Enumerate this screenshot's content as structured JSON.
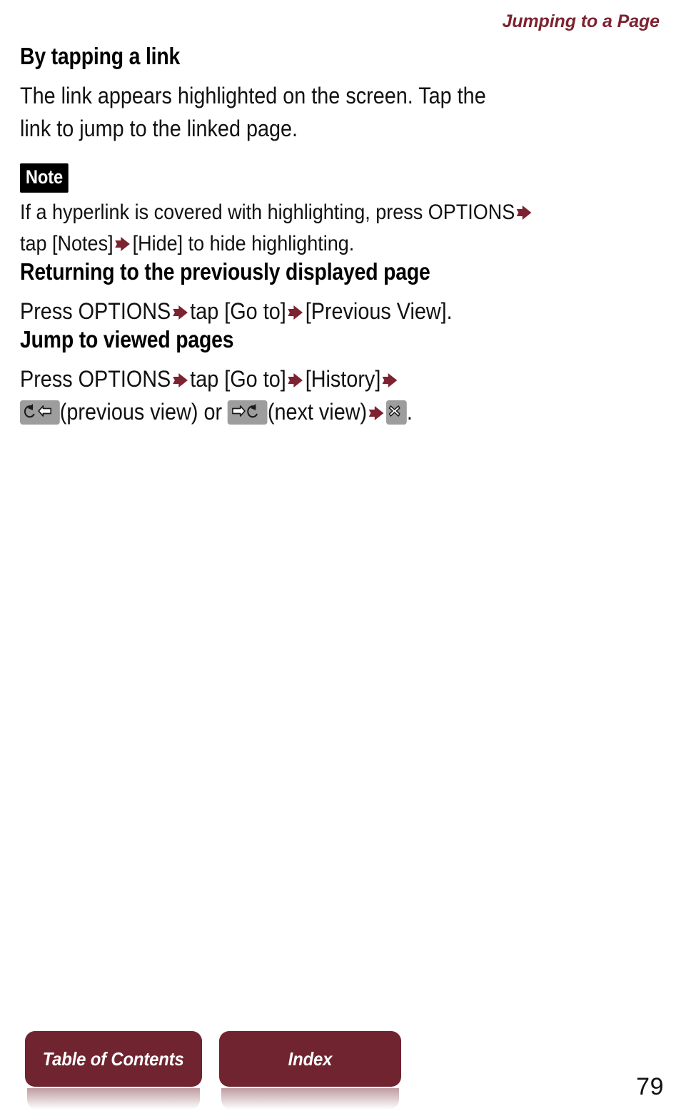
{
  "header": {
    "running_title": "Jumping to a Page"
  },
  "sections": [
    {
      "heading": "By tapping a link",
      "body_line_1": "The link appears highlighted on the screen. Tap the",
      "body_line_2": "link to jump to the linked page."
    },
    {
      "heading": "Returning to the previously displayed page",
      "body_parts": {
        "p1": "Press OPTIONS",
        "p2": "tap [Go to]",
        "p3": "[Previous View]."
      }
    },
    {
      "heading": "Jump to viewed pages",
      "body_parts": {
        "p1": "Press OPTIONS",
        "p2": "tap [Go to]",
        "p3": "[History]",
        "p4": "(previous view) or",
        "p5": "(next view)",
        "p6": "."
      }
    }
  ],
  "note": {
    "badge_label": "Note",
    "line_1_a": "If a hyperlink is covered with highlighting, press OPTIONS",
    "line_2_a": "tap [Notes]",
    "line_2_b": "[Hide] to hide highlighting."
  },
  "icons": {
    "arrow": "red-right-arrow-icon",
    "previous_view": "previous-view-key-icon",
    "next_view": "next-view-key-icon",
    "close": "close-key-icon"
  },
  "footer": {
    "toc_label": "Table of Contents",
    "index_label": "Index",
    "page_number": "79"
  },
  "colors": {
    "accent_red": "#7c2230",
    "button_red": "#6f242f",
    "key_gray": "#9d9d9d",
    "text_black": "#111111"
  }
}
